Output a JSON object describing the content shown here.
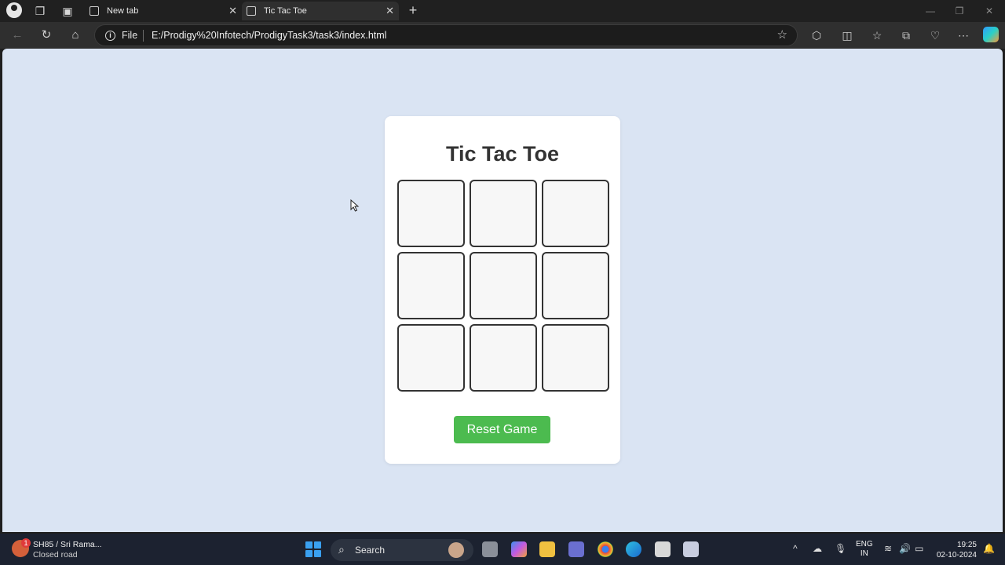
{
  "browser": {
    "tabs": [
      {
        "title": "New tab",
        "close": "✕"
      },
      {
        "title": "Tic Tac Toe",
        "close": "✕"
      }
    ],
    "address": {
      "scheme_label": "File",
      "url": "E:/Prodigy%20Infotech/ProdigyTask3/task3/index.html"
    }
  },
  "page": {
    "title": "Tic Tac Toe",
    "board_cells": [
      "",
      "",
      "",
      "",
      "",
      "",
      "",
      "",
      ""
    ],
    "reset_label": "Reset Game"
  },
  "taskbar": {
    "weather_badge": "1",
    "weather_line1": "SH85 / Sri Rama...",
    "weather_line2": "Closed road",
    "search_label": "Search",
    "lang_line1": "ENG",
    "lang_line2": "IN",
    "time": "19:25",
    "date": "02-10-2024"
  },
  "colors": {
    "page_background": "#dae4f3",
    "reset_button": "#4cbb4f",
    "cell_border": "#333333"
  }
}
